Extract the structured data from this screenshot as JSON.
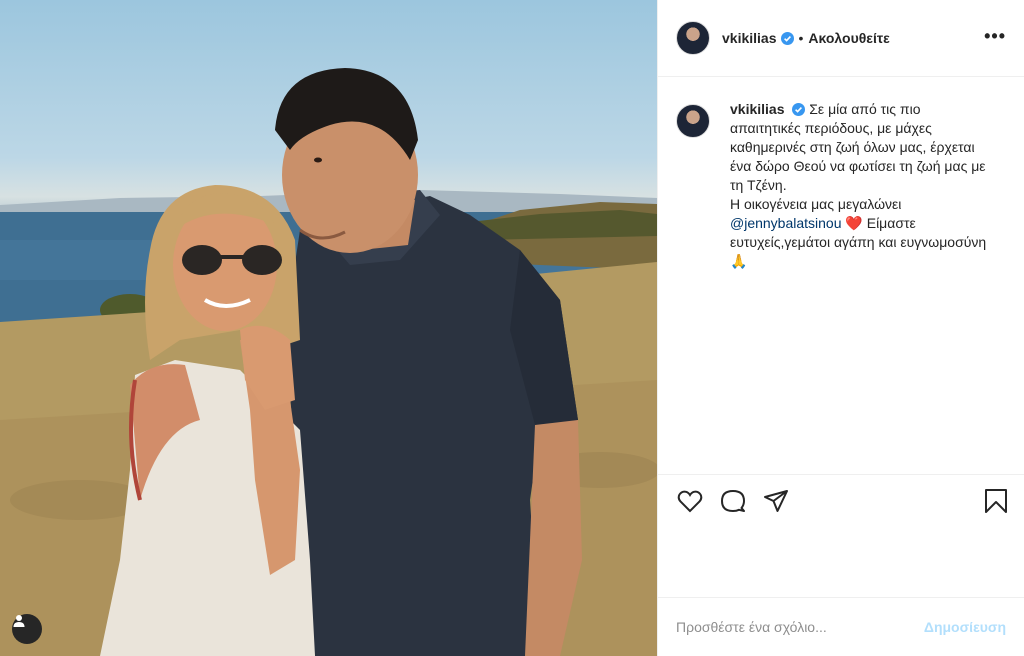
{
  "post": {
    "username": "vkikilias",
    "separator": "•",
    "follow_label": "Ακολουθείτε",
    "more_label": "•••",
    "caption_text": "Σε μία από τις πιο απαιτητικές περιόδους, με μάχες καθημερινές στη ζωή όλων μας, έρχεται ένα δώρο Θεού να φωτίσει τη ζωή μας με τη Τζένη.",
    "caption_line2": "Η οικογένεια μας μεγαλώνει",
    "mention": "@jennybalatsinou",
    "caption_end": "Είμαστε ευτυχείς,γεμάτοι αγάπη και ευγνωμοσύνη",
    "heart_emoji": "❤️",
    "pray_emoji": "🙏"
  },
  "comment": {
    "placeholder": "Προσθέστε ένα σχόλιο...",
    "post_label": "Δημοσίευση"
  },
  "colors": {
    "verified": "#3897f0",
    "post_button": "#b2dffc",
    "mention": "#00376b"
  },
  "icons": [
    "user-tag-icon",
    "verified-badge-icon",
    "more-options-icon",
    "like-heart-icon",
    "comment-bubble-icon",
    "share-plane-icon",
    "save-bookmark-icon"
  ]
}
